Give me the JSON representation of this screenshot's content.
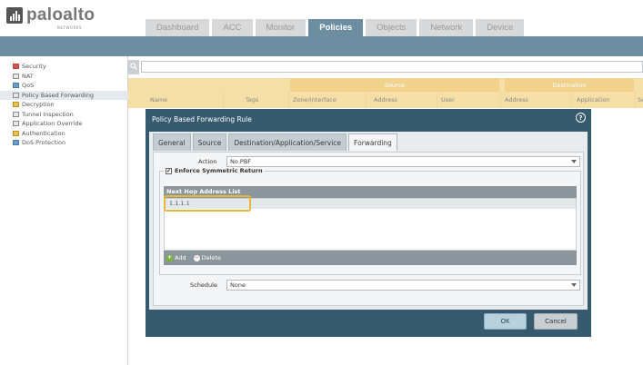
{
  "brand": {
    "logo_text": "paloalto",
    "logo_subtext": "NETWORKS"
  },
  "nav_tabs": [
    "Dashboard",
    "ACC",
    "Monitor",
    "Policies",
    "Objects",
    "Network",
    "Device"
  ],
  "active_tab": "Policies",
  "sidebar": {
    "items": [
      {
        "label": "Security",
        "icon": "shield-icon"
      },
      {
        "label": "NAT",
        "icon": "nat-icon"
      },
      {
        "label": "QoS",
        "icon": "qos-icon"
      },
      {
        "label": "Policy Based Forwarding",
        "icon": "pbf-icon",
        "selected": true
      },
      {
        "label": "Decryption",
        "icon": "lock-icon"
      },
      {
        "label": "Tunnel Inspection",
        "icon": "tunnel-icon"
      },
      {
        "label": "Application Override",
        "icon": "app-override-icon"
      },
      {
        "label": "Authentication",
        "icon": "key-icon"
      },
      {
        "label": "DoS Protection",
        "icon": "dos-icon"
      }
    ]
  },
  "grid": {
    "groups": [
      "Source",
      "Destination"
    ],
    "columns": [
      "Name",
      "Tags",
      "Zone/Interface",
      "Address",
      "User",
      "Address",
      "Application",
      "Se"
    ]
  },
  "dialog": {
    "title": "Policy Based Forwarding Rule",
    "tabs": [
      "General",
      "Source",
      "Destination/Application/Service",
      "Forwarding"
    ],
    "active_tab": "Forwarding",
    "action_label": "Action",
    "action_value": "No PBF",
    "enforce_label": "Enforce Symmetric Return",
    "enforce_checked": true,
    "next_hop_header": "Next Hop Address List",
    "next_hop_entries": [
      "1.1.1.1"
    ],
    "add_label": "Add",
    "delete_label": "Delete",
    "schedule_label": "Schedule",
    "schedule_value": "None",
    "ok_label": "OK",
    "cancel_label": "Cancel"
  },
  "colors": {
    "nav_bar": "#6d8ea1",
    "dialog_frame": "#365a6e",
    "grid_header": "#f5dfa6",
    "highlight": "#e8b43a"
  }
}
